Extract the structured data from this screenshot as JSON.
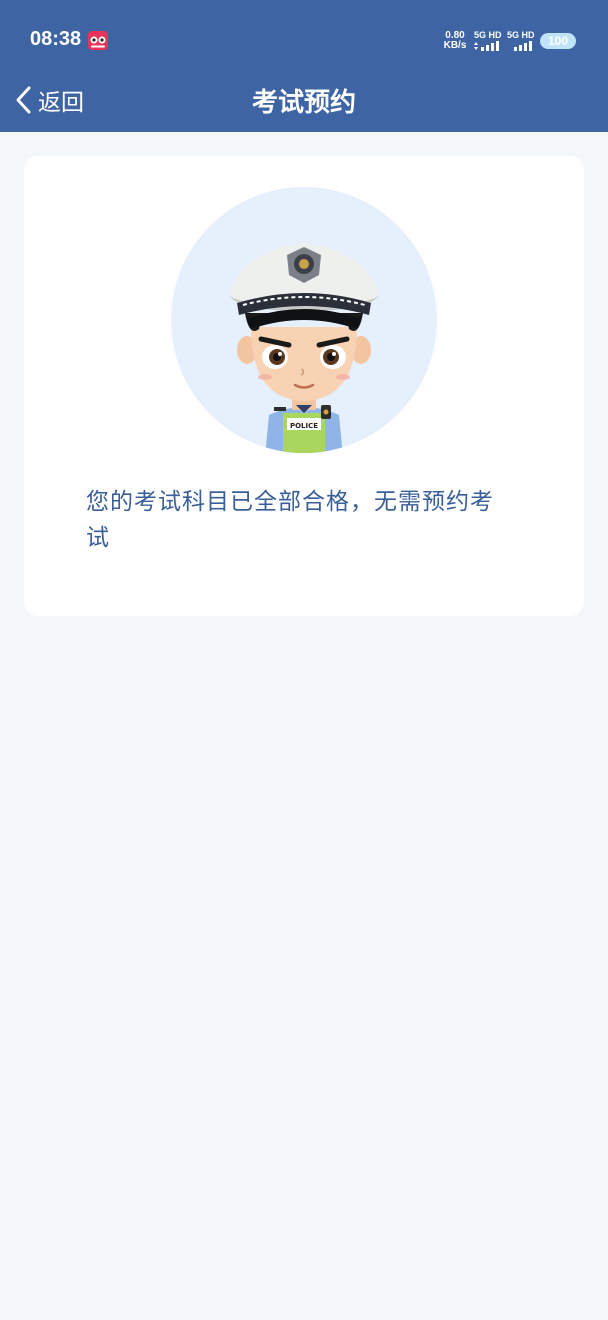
{
  "status_bar": {
    "time": "08:38",
    "net_speed_value": "0.80",
    "net_speed_unit": "KB/s",
    "signal_1_label": "5G HD",
    "signal_2_label": "5G HD",
    "battery": "100"
  },
  "nav": {
    "back_label": "返回",
    "title": "考试预约"
  },
  "card": {
    "badge_text": "POLICE",
    "message": "您的考试科目已全部合格，无需预约考试"
  },
  "colors": {
    "header_bg": "#3e64a3",
    "page_bg": "#f3f7f9",
    "message_text": "#3a5f98",
    "avatar_circle": "#e6effc"
  }
}
